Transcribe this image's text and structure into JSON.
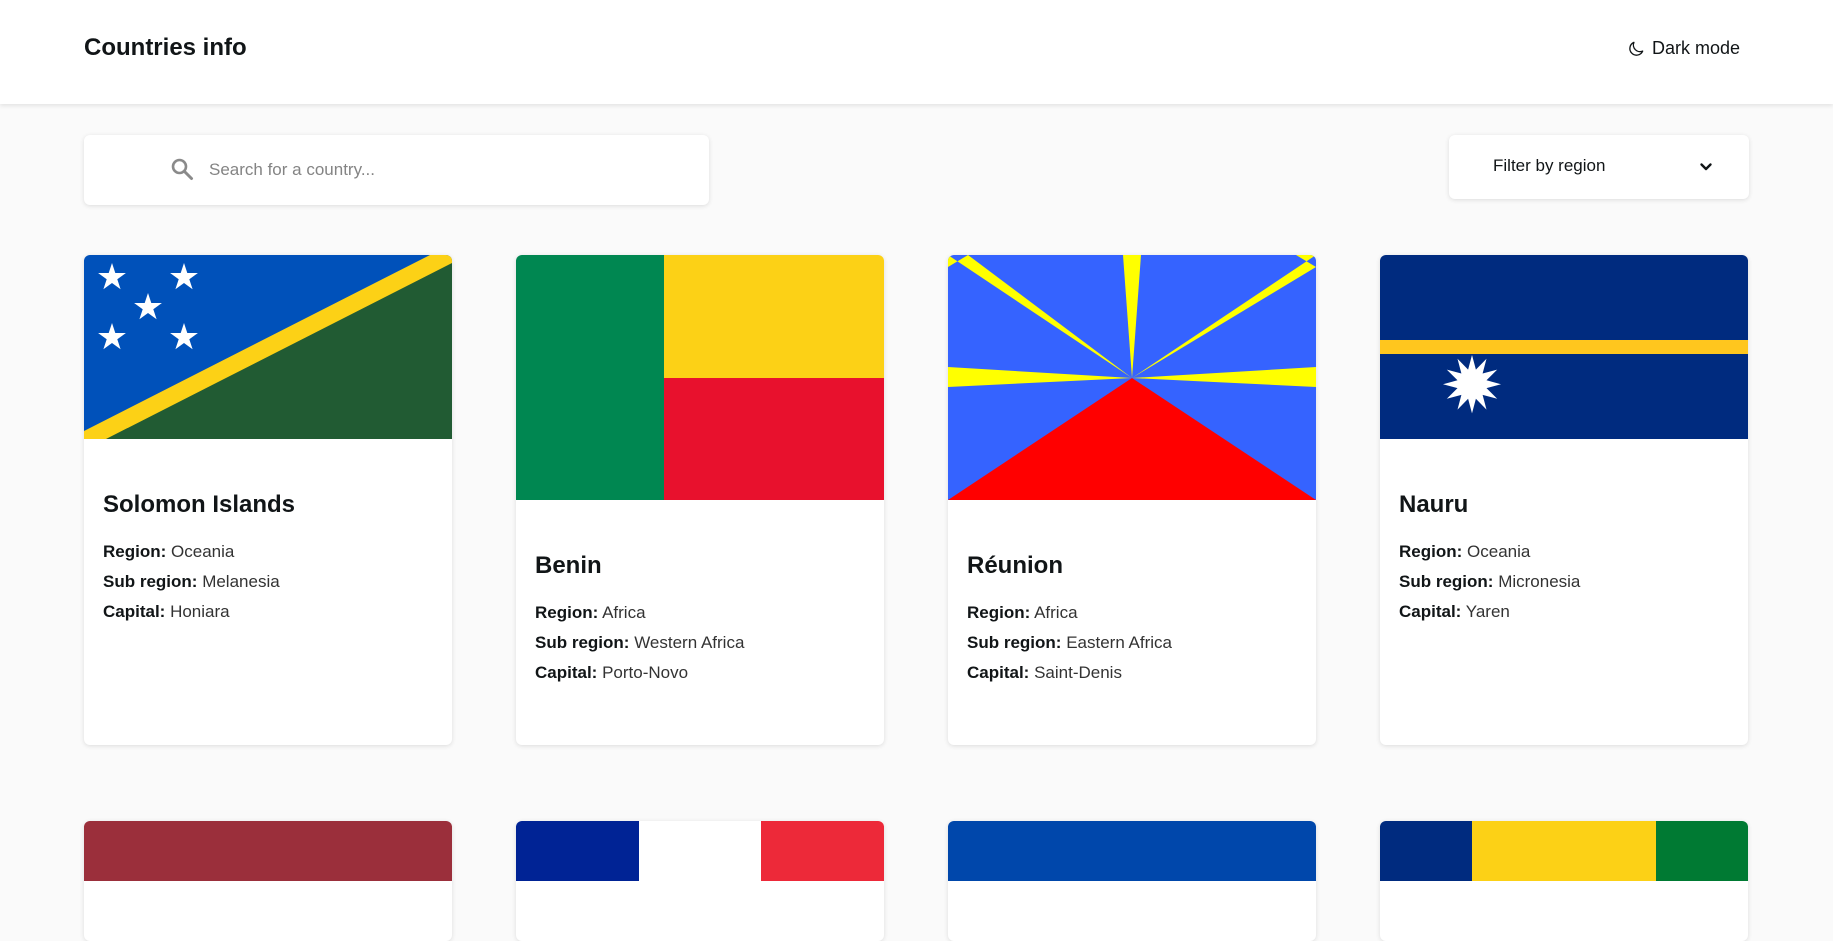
{
  "header": {
    "title": "Countries info",
    "dark_mode_label": "Dark mode"
  },
  "search": {
    "placeholder": "Search for a country...",
    "value": ""
  },
  "filter": {
    "label": "Filter by region"
  },
  "labels": {
    "region": "Region:",
    "subregion": "Sub region:",
    "capital": "Capital:"
  },
  "countries": [
    {
      "name": "Solomon Islands",
      "region": "Oceania",
      "subregion": "Melanesia",
      "capital": "Honiara"
    },
    {
      "name": "Benin",
      "region": "Africa",
      "subregion": "Western Africa",
      "capital": "Porto-Novo"
    },
    {
      "name": "Réunion",
      "region": "Africa",
      "subregion": "Eastern Africa",
      "capital": "Saint-Denis"
    },
    {
      "name": "Nauru",
      "region": "Oceania",
      "subregion": "Micronesia",
      "capital": "Yaren"
    }
  ],
  "colors": {
    "background": "#fafafa",
    "element": "#ffffff",
    "text": "#111517",
    "placeholder": "#848484"
  }
}
